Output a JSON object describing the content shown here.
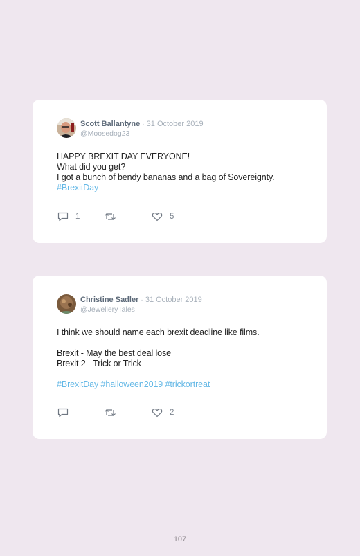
{
  "tweets": [
    {
      "author": "Scott Ballantyne",
      "separator": "·",
      "date": "31 October 2019",
      "handle": "@Moosedog23",
      "lines": [
        "HAPPY BREXIT DAY EVERYONE!",
        "What did you get?",
        "I got a bunch of bendy bananas and a bag of Sovereignty."
      ],
      "hashtags": "#BrexitDay",
      "replies": "1",
      "retweets": "",
      "likes": "5"
    },
    {
      "author": "Christine Sadler",
      "separator": "·",
      "date": "31 October 2019",
      "handle": "@JewelleryTales",
      "lines": [
        "I think we should name each brexit deadline like films.",
        "",
        "Brexit - May the best deal lose",
        "Brexit 2 - Trick or Trick",
        ""
      ],
      "hashtags": "#BrexitDay #halloween2019 #trickortreat",
      "replies": "",
      "retweets": "",
      "likes": "2"
    }
  ],
  "icons": {
    "reply": "speech-bubble-icon",
    "retweet": "retweet-icon",
    "like": "heart-icon"
  },
  "colors": {
    "background": "#efe7ef",
    "card": "#ffffff",
    "hashtag": "#64b8e6",
    "name": "#5e6b7a"
  },
  "page_number": "107"
}
